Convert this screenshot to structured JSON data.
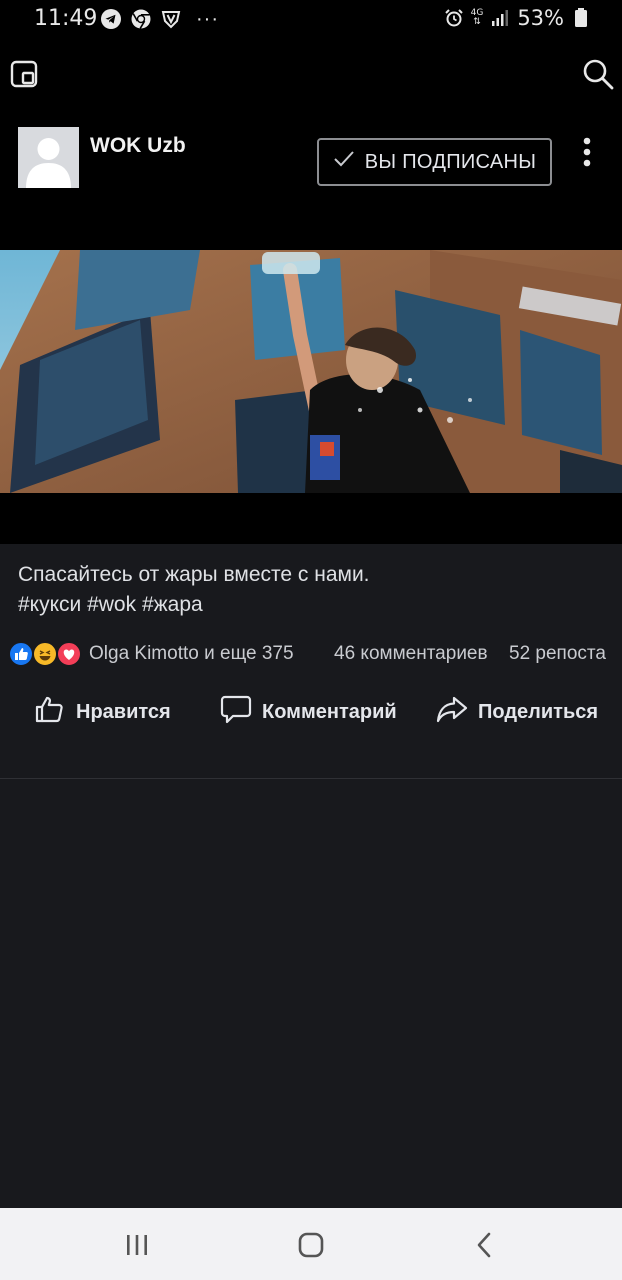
{
  "status_bar": {
    "time": "11:49",
    "network": "4G",
    "battery": "53%"
  },
  "page": {
    "name": "WOK Uzb",
    "subscribe_label": "ВЫ ПОДПИСАНЫ"
  },
  "post": {
    "text_line1": "Спасайтесь от жары вместе с нами.",
    "text_line2": "#кукси #wok #жара",
    "reactions_names": "Olga Kimotto и еще 375",
    "comments": "46 комментариев",
    "reposts": "52 репоста"
  },
  "actions": {
    "like": "Нравится",
    "comment": "Комментарий",
    "share": "Поделиться"
  },
  "icons": {
    "pip": "picture-in-picture-icon",
    "search": "search-icon",
    "more": "more-vertical-icon",
    "like": "thumbs-up-icon",
    "comment": "comment-icon",
    "share": "share-icon"
  },
  "colors": {
    "background": "#18191d",
    "like_blue": "#1877f2",
    "haha_yellow": "#f7b928",
    "love_red": "#f33e58"
  }
}
